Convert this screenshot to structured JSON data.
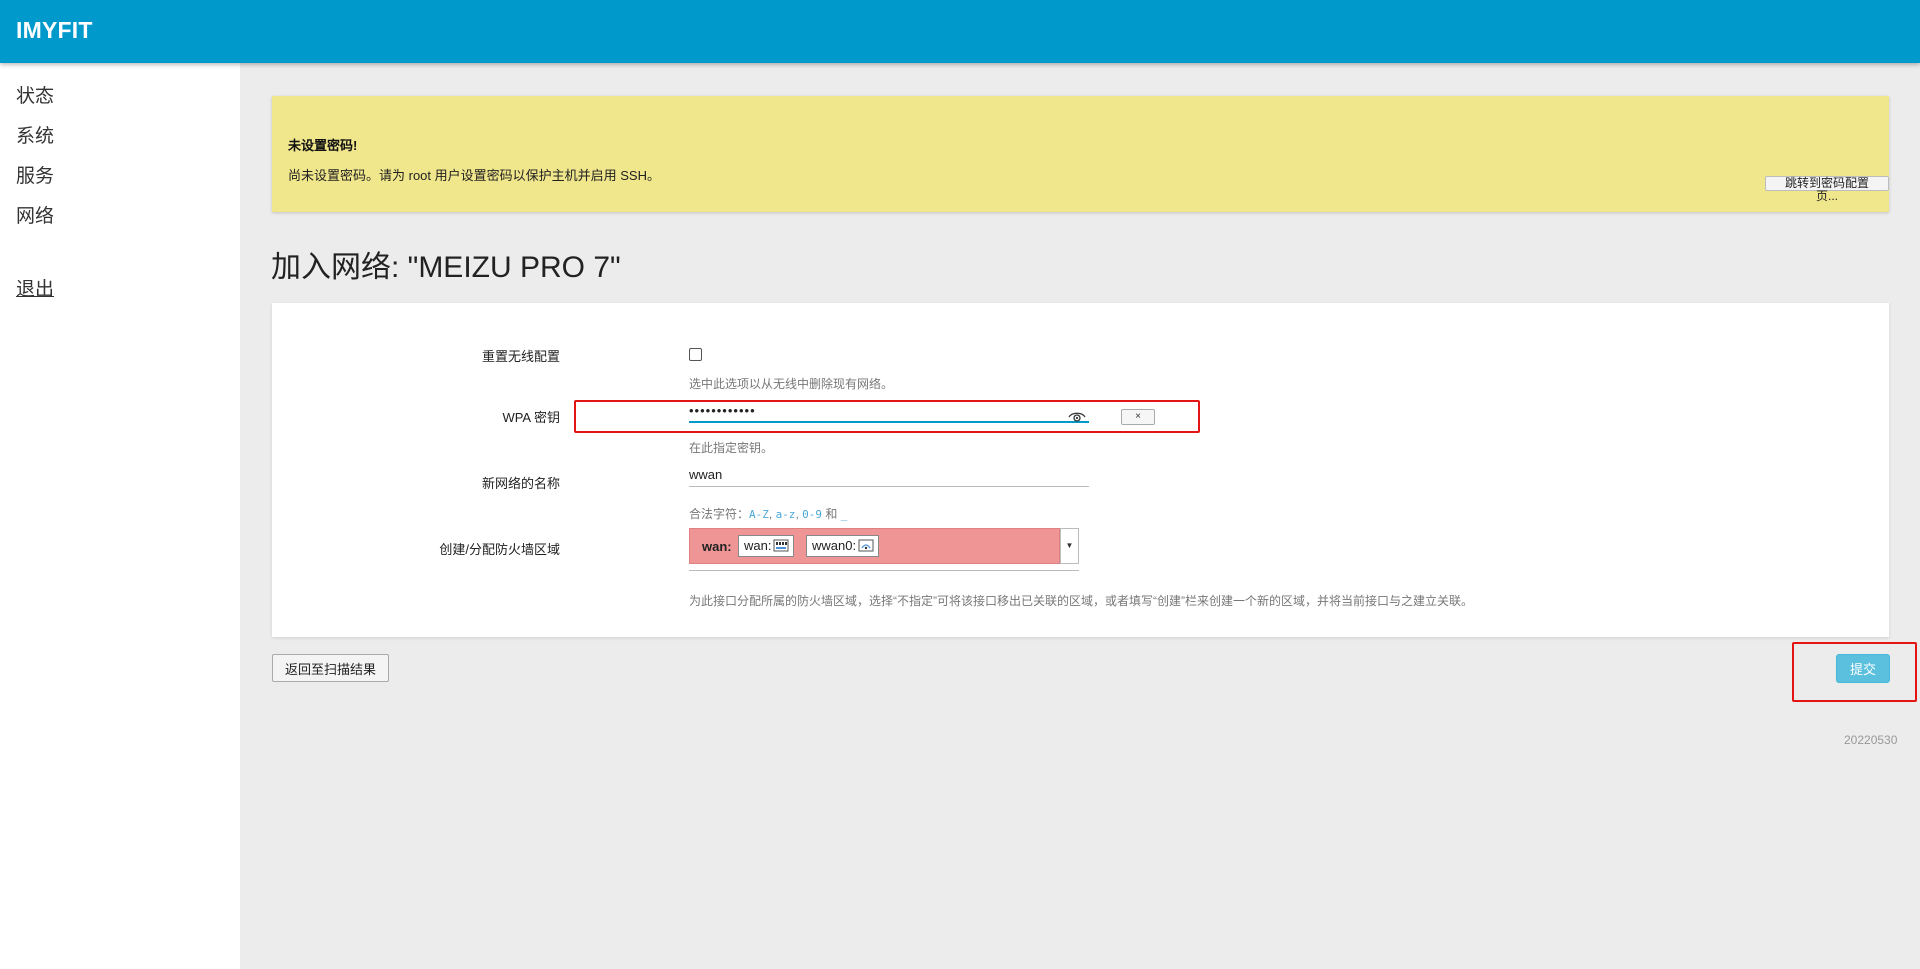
{
  "header": {
    "brand": "IMYFIT"
  },
  "sidebar": {
    "items": [
      {
        "label": "状态"
      },
      {
        "label": "系统"
      },
      {
        "label": "服务"
      },
      {
        "label": "网络"
      }
    ],
    "logout": "退出"
  },
  "alert": {
    "title": "未设置密码!",
    "text": "尚未设置密码。请为 root 用户设置密码以保护主机并启用 SSH。",
    "button": "跳转到密码配置页..."
  },
  "page": {
    "title": "加入网络: \"MEIZU PRO 7\""
  },
  "form": {
    "reset": {
      "label": "重置无线配置",
      "help": "选中此选项以从无线中删除现有网络。",
      "checked": false
    },
    "wpa": {
      "label": "WPA 密钥",
      "value": "••••••••••••",
      "help": "在此指定密钥。",
      "clear_label": "×"
    },
    "name": {
      "label": "新网络的名称",
      "value": "wwan",
      "help_prefix": "合法字符：",
      "help_chars_1": "A-Z",
      "help_sep_1": ", ",
      "help_chars_2": "a-z",
      "help_sep_2": ", ",
      "help_chars_3": "0-9",
      "help_and": " 和 ",
      "help_chars_4": "_"
    },
    "zone": {
      "label": "创建/分配防火墙区域",
      "zone_name": "wan:",
      "chips": [
        "wan:",
        "wwan0:"
      ],
      "help": "为此接口分配所属的防火墙区域，选择“不指定”可将该接口移出已关联的区域，或者填写“创建”栏来创建一个新的区域，并将当前接口与之建立关联。"
    }
  },
  "actions": {
    "back": "返回至扫描结果",
    "submit": "提交"
  },
  "footer": {
    "version": "20220530"
  },
  "colors": {
    "header": "#0099cc",
    "alert": "#f0e68c",
    "zone": "#f09595",
    "submit": "#5bc0de",
    "highlight": "#e41414"
  }
}
